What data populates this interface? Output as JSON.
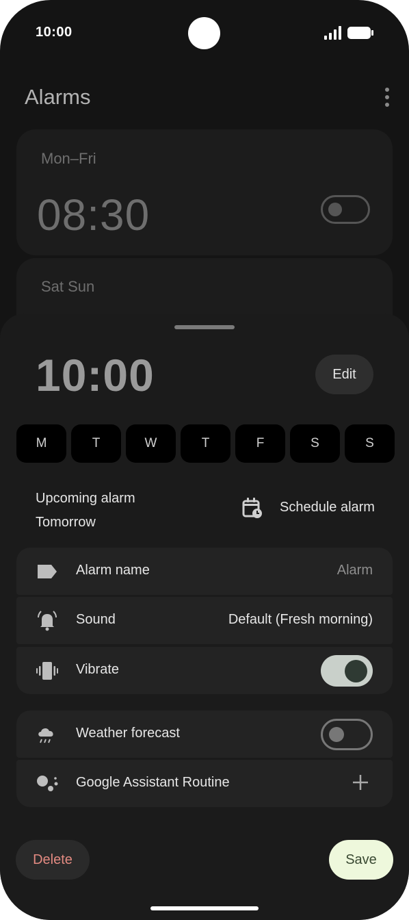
{
  "status_bar": {
    "time": "10:00"
  },
  "app": {
    "title": "Alarms"
  },
  "alarm_cards": [
    {
      "days": "Mon–Fri",
      "time": "08:30",
      "enabled": false
    },
    {
      "days": "Sat Sun"
    }
  ],
  "editor": {
    "time": "10:00",
    "edit_label": "Edit",
    "days": [
      "M",
      "T",
      "W",
      "T",
      "F",
      "S",
      "S"
    ],
    "upcoming_label": "Upcoming alarm",
    "upcoming_when": "Tomorrow",
    "schedule_label": "Schedule alarm",
    "settings": [
      {
        "label": "Alarm name",
        "value": "Alarm",
        "icon": "label-icon"
      },
      {
        "label": "Sound",
        "value": "Default (Fresh morning)",
        "icon": "bell-icon"
      },
      {
        "label": "Vibrate",
        "icon": "vibrate-icon",
        "toggle": true
      }
    ],
    "extras": [
      {
        "label": "Weather forecast",
        "icon": "weather-icon",
        "toggle": false
      },
      {
        "label": "Google Assistant Routine",
        "icon": "assistant-icon",
        "action": "add-icon"
      }
    ],
    "delete_label": "Delete",
    "save_label": "Save"
  },
  "colors": {
    "accent_toggle": "#c9d0ca",
    "save_bg": "#eef8dc",
    "delete_text": "#e48b82"
  }
}
